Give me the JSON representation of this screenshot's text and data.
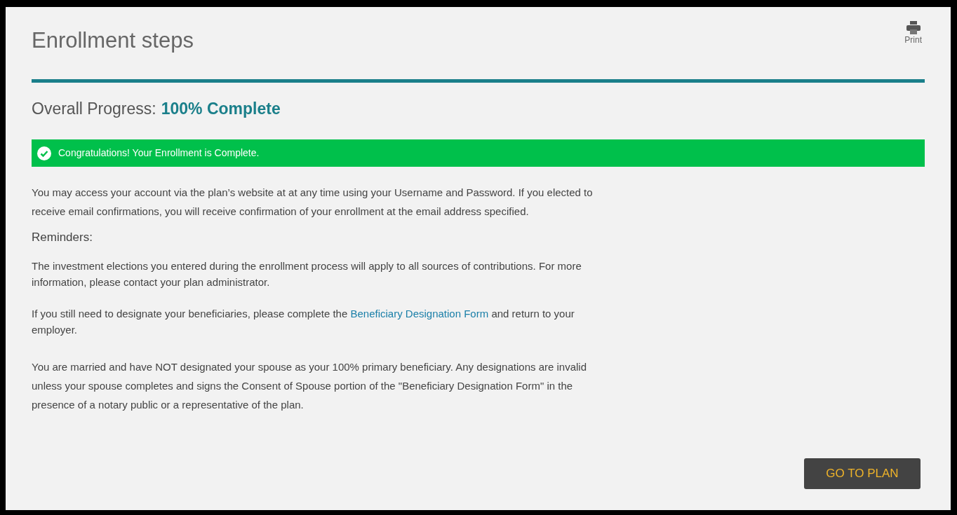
{
  "header": {
    "title": "Enrollment steps",
    "print_label": "Print"
  },
  "progress": {
    "level": 1,
    "label": "Overall Progress:",
    "value": "100% Complete"
  },
  "alert": {
    "kind": "success",
    "message": "Congratulations! Your Enrollment is Complete."
  },
  "intro": "You may access your account via the plan’s website at at any time using your Username and Password. If you elected to receive email confirmations, you will receive confirmation of your enrollment at the email address specified.",
  "reminders": {
    "heading": "Reminders:",
    "items": [
      {
        "kind": "text",
        "text": "The investment elections you entered during the enrollment process will apply to all sources of contributions. For more information, please contact your plan administrator."
      },
      {
        "kind": "link",
        "before": "If you still need to designate your beneficiaries, please complete the ",
        "link": "Beneficiary Designation Form",
        "after": " and return to your employer."
      },
      {
        "kind": "text",
        "text": "You are married and have NOT designated your spouse as your 100% primary beneficiary. Any designations are invalid unless your spouse completes and signs the Consent of Spouse portion of the \"Beneficiary Designation Form\" in the presence of a notary public or a representative of the plan."
      }
    ]
  },
  "button": "GO TO PLAN"
}
